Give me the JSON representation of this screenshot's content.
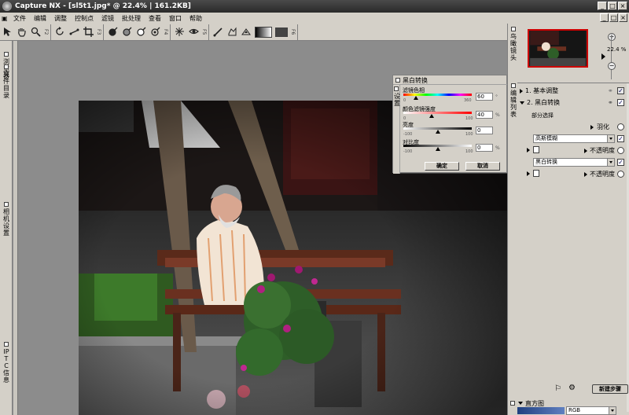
{
  "window": {
    "title": "Capture NX - [sl5t1.jpg* @ 22.4% | 161.2KB]",
    "minimize": "_",
    "maximize": "□",
    "close": "×"
  },
  "menu": {
    "items": [
      "文件",
      "编辑",
      "调整",
      "控制点",
      "滤镜",
      "批处理",
      "查看",
      "窗口",
      "帮助"
    ]
  },
  "toolbar": {
    "group_nums": [
      "F2",
      "F3",
      "F4",
      "F5",
      "F6"
    ]
  },
  "left_dock": {
    "tabs": [
      "浏览器",
      "文件目录",
      "相机设置",
      "IPTC信息"
    ]
  },
  "bw_panel": {
    "title": "黑白转换",
    "side_label": "设置",
    "hue_label": "滤镜色相",
    "hue_min": "0",
    "hue_max": "360",
    "hue_value": "60",
    "hue_unit": "°",
    "sat_label": "颜色滤镜强度",
    "sat_min": "0",
    "sat_max": "100",
    "sat_value": "40",
    "sat_unit": "%",
    "bright_label": "亮度",
    "bright_min": "-100",
    "bright_max": "100",
    "bright_value": "0",
    "contrast_label": "对比度",
    "contrast_min": "-100",
    "contrast_max": "100",
    "contrast_value": "0",
    "contrast_unit": "%",
    "ok": "确定",
    "cancel": "取消"
  },
  "right_dock": {
    "bird_tab": "鸟瞰镜头",
    "edit_tab": "编辑列表",
    "zoom": "22.4 %",
    "zoom_in": "+",
    "zoom_out": "−"
  },
  "edit_list": {
    "step1": "1. 基本调整",
    "step2": "2. 黑白转换",
    "partial": "部分选择",
    "feather": "羽化",
    "blend_mode": "高斯模糊",
    "opacity1": "不透明度",
    "bw_sub": "黑白转换",
    "opacity2": "不透明度",
    "new_step": "新建步骤",
    "check": "✓"
  },
  "histogram": {
    "label": "直方图",
    "channel": "RGB"
  }
}
